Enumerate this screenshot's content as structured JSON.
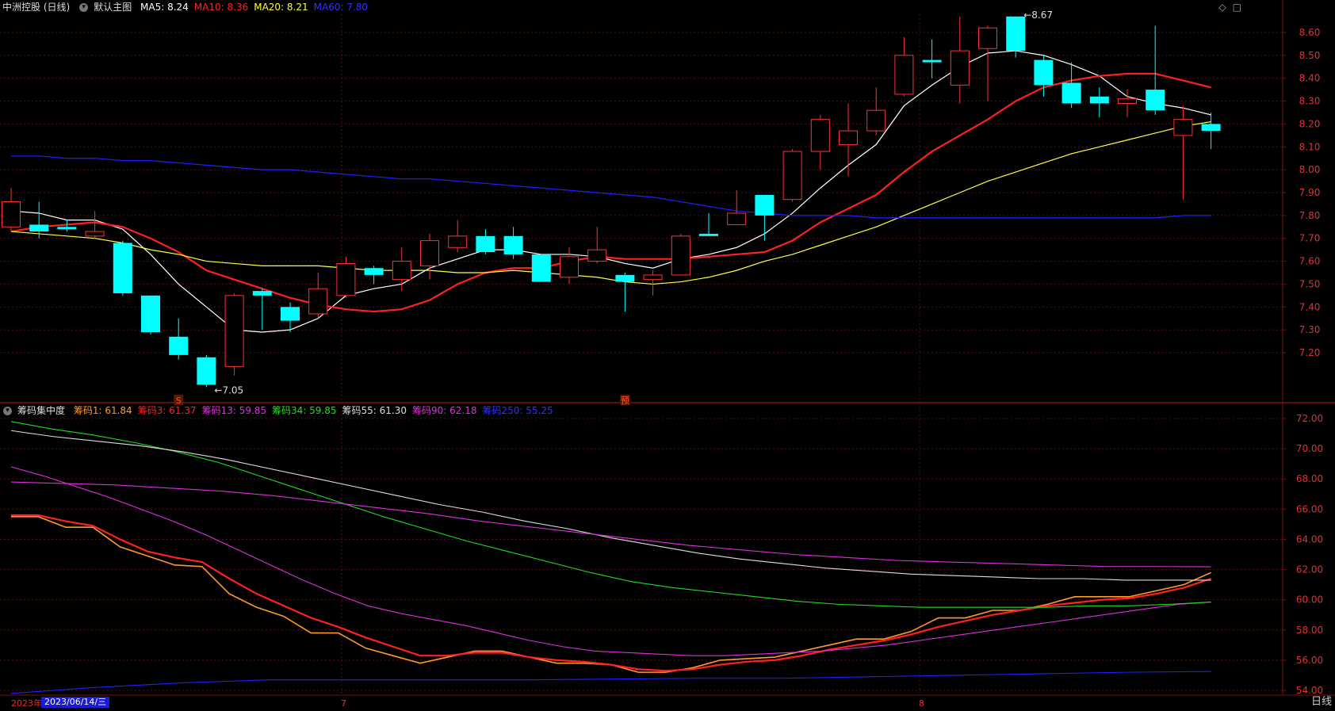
{
  "chart_data": [
    {
      "type": "candlestick",
      "title": "中洲控股 (日线)",
      "subtitle": "默认主图",
      "ma_labels": [
        {
          "text": "MA5: 8.24",
          "color": "#ffffff"
        },
        {
          "text": "MA10: 8.36",
          "color": "#ff2020"
        },
        {
          "text": "MA20: 8.21",
          "color": "#ffff40"
        },
        {
          "text": "MA60: 7.80",
          "color": "#3030ff"
        }
      ],
      "y_ticks": [
        "7.20",
        "7.30",
        "7.40",
        "7.50",
        "7.60",
        "7.70",
        "7.80",
        "7.90",
        "8.00",
        "8.10",
        "8.20",
        "8.30",
        "8.40",
        "8.50",
        "8.60"
      ],
      "ylim": [
        7.0,
        8.72
      ],
      "candles": [
        {
          "o": 7.75,
          "h": 7.92,
          "l": 7.73,
          "c": 7.86
        },
        {
          "o": 7.76,
          "h": 7.86,
          "l": 7.7,
          "c": 7.73
        },
        {
          "o": 7.75,
          "h": 7.78,
          "l": 7.73,
          "c": 7.74
        },
        {
          "o": 7.71,
          "h": 7.82,
          "l": 7.7,
          "c": 7.73
        },
        {
          "o": 7.68,
          "h": 7.69,
          "l": 7.45,
          "c": 7.46
        },
        {
          "o": 7.45,
          "h": 7.45,
          "l": 7.28,
          "c": 7.29
        },
        {
          "o": 7.27,
          "h": 7.35,
          "l": 7.17,
          "c": 7.19
        },
        {
          "o": 7.18,
          "h": 7.19,
          "l": 7.05,
          "c": 7.06
        },
        {
          "o": 7.14,
          "h": 7.46,
          "l": 7.1,
          "c": 7.45
        },
        {
          "o": 7.47,
          "h": 7.48,
          "l": 7.3,
          "c": 7.45
        },
        {
          "o": 7.4,
          "h": 7.42,
          "l": 7.29,
          "c": 7.34
        },
        {
          "o": 7.37,
          "h": 7.55,
          "l": 7.35,
          "c": 7.48
        },
        {
          "o": 7.45,
          "h": 7.62,
          "l": 7.44,
          "c": 7.59
        },
        {
          "o": 7.57,
          "h": 7.58,
          "l": 7.5,
          "c": 7.54
        },
        {
          "o": 7.52,
          "h": 7.66,
          "l": 7.47,
          "c": 7.6
        },
        {
          "o": 7.58,
          "h": 7.72,
          "l": 7.52,
          "c": 7.69
        },
        {
          "o": 7.66,
          "h": 7.78,
          "l": 7.64,
          "c": 7.71
        },
        {
          "o": 7.71,
          "h": 7.74,
          "l": 7.63,
          "c": 7.64
        },
        {
          "o": 7.71,
          "h": 7.75,
          "l": 7.61,
          "c": 7.63
        },
        {
          "o": 7.63,
          "h": 7.63,
          "l": 7.51,
          "c": 7.51
        },
        {
          "o": 7.53,
          "h": 7.66,
          "l": 7.5,
          "c": 7.62
        },
        {
          "o": 7.6,
          "h": 7.75,
          "l": 7.59,
          "c": 7.65
        },
        {
          "o": 7.54,
          "h": 7.55,
          "l": 7.38,
          "c": 7.51
        },
        {
          "o": 7.52,
          "h": 7.56,
          "l": 7.45,
          "c": 7.54
        },
        {
          "o": 7.54,
          "h": 7.72,
          "l": 7.54,
          "c": 7.71
        },
        {
          "o": 7.72,
          "h": 7.81,
          "l": 7.71,
          "c": 7.71
        },
        {
          "o": 7.76,
          "h": 7.91,
          "l": 7.76,
          "c": 7.81
        },
        {
          "o": 7.89,
          "h": 7.89,
          "l": 7.69,
          "c": 7.8
        },
        {
          "o": 7.87,
          "h": 8.09,
          "l": 7.86,
          "c": 8.08
        },
        {
          "o": 8.08,
          "h": 8.24,
          "l": 8.0,
          "c": 8.22
        },
        {
          "o": 8.11,
          "h": 8.29,
          "l": 7.97,
          "c": 8.17
        },
        {
          "o": 8.17,
          "h": 8.36,
          "l": 8.15,
          "c": 8.26
        },
        {
          "o": 8.33,
          "h": 8.58,
          "l": 8.32,
          "c": 8.5
        },
        {
          "o": 8.48,
          "h": 8.57,
          "l": 8.4,
          "c": 8.47
        },
        {
          "o": 8.37,
          "h": 8.67,
          "l": 8.29,
          "c": 8.52
        },
        {
          "o": 8.53,
          "h": 8.63,
          "l": 8.3,
          "c": 8.62
        },
        {
          "o": 8.67,
          "h": 8.67,
          "l": 8.49,
          "c": 8.52
        },
        {
          "o": 8.48,
          "h": 8.5,
          "l": 8.32,
          "c": 8.37
        },
        {
          "o": 8.38,
          "h": 8.47,
          "l": 8.27,
          "c": 8.29
        },
        {
          "o": 8.32,
          "h": 8.36,
          "l": 8.23,
          "c": 8.29
        },
        {
          "o": 8.29,
          "h": 8.35,
          "l": 8.23,
          "c": 8.31
        },
        {
          "o": 8.35,
          "h": 8.63,
          "l": 8.24,
          "c": 8.26
        },
        {
          "o": 8.15,
          "h": 8.28,
          "l": 7.87,
          "c": 8.22
        },
        {
          "o": 8.2,
          "h": 8.25,
          "l": 8.09,
          "c": 8.17
        }
      ],
      "ma": [
        {
          "name": "MA5",
          "color": "#ffffff",
          "values": [
            7.82,
            7.81,
            7.78,
            7.78,
            7.74,
            7.63,
            7.5,
            7.4,
            7.3,
            7.29,
            7.3,
            7.35,
            7.45,
            7.48,
            7.5,
            7.57,
            7.61,
            7.65,
            7.65,
            7.63,
            7.63,
            7.62,
            7.59,
            7.57,
            7.61,
            7.63,
            7.66,
            7.72,
            7.81,
            7.92,
            8.02,
            8.11,
            8.28,
            8.37,
            8.45,
            8.51,
            8.52,
            8.5,
            8.46,
            8.41,
            8.32,
            8.29,
            8.27,
            8.24
          ]
        },
        {
          "name": "MA10",
          "color": "#ff2020",
          "values": [
            7.73,
            7.75,
            7.76,
            7.77,
            7.75,
            7.7,
            7.64,
            7.56,
            7.52,
            7.48,
            7.44,
            7.41,
            7.39,
            7.38,
            7.39,
            7.43,
            7.5,
            7.55,
            7.57,
            7.57,
            7.6,
            7.62,
            7.61,
            7.61,
            7.61,
            7.62,
            7.63,
            7.64,
            7.69,
            7.77,
            7.83,
            7.89,
            7.99,
            8.08,
            8.15,
            8.22,
            8.3,
            8.36,
            8.39,
            8.41,
            8.42,
            8.42,
            8.39,
            8.36
          ]
        },
        {
          "name": "MA20",
          "color": "#ffff40",
          "values": [
            7.73,
            7.72,
            7.71,
            7.7,
            7.68,
            7.65,
            7.63,
            7.6,
            7.59,
            7.58,
            7.58,
            7.58,
            7.57,
            7.56,
            7.56,
            7.56,
            7.55,
            7.55,
            7.56,
            7.55,
            7.54,
            7.53,
            7.51,
            7.5,
            7.51,
            7.53,
            7.56,
            7.6,
            7.63,
            7.67,
            7.71,
            7.75,
            7.8,
            7.85,
            7.9,
            7.95,
            7.99,
            8.03,
            8.07,
            8.1,
            8.13,
            8.16,
            8.19,
            8.21
          ]
        },
        {
          "name": "MA60",
          "color": "#2020ff",
          "values": [
            8.06,
            8.06,
            8.05,
            8.05,
            8.04,
            8.04,
            8.03,
            8.02,
            8.01,
            8.0,
            8.0,
            7.99,
            7.98,
            7.97,
            7.96,
            7.96,
            7.95,
            7.94,
            7.93,
            7.92,
            7.91,
            7.9,
            7.89,
            7.88,
            7.86,
            7.84,
            7.82,
            7.81,
            7.8,
            7.8,
            7.8,
            7.79,
            7.79,
            7.79,
            7.79,
            7.79,
            7.79,
            7.79,
            7.79,
            7.79,
            7.79,
            7.79,
            7.8,
            7.8
          ]
        }
      ],
      "annotations": [
        {
          "text": "7.05",
          "index": 7,
          "price": 7.05
        },
        {
          "text": "8.67",
          "index": 36,
          "price": 8.67
        }
      ],
      "markers": [
        {
          "text": "S",
          "index": 6
        },
        {
          "text": "预",
          "index": 22
        }
      ]
    },
    {
      "type": "line",
      "title": "筹码集中度",
      "labels": [
        {
          "text": "筹码1: 61.84",
          "color": "#ff9930"
        },
        {
          "text": "筹码3: 61.37",
          "color": "#ff2020"
        },
        {
          "text": "筹码13: 59.85",
          "color": "#dd30dd"
        },
        {
          "text": "筹码34: 59.85",
          "color": "#20dd20"
        },
        {
          "text": "筹码55: 61.30",
          "color": "#dddddd"
        },
        {
          "text": "筹码90: 62.18",
          "color": "#dd30dd"
        },
        {
          "text": "筹码250: 55.25",
          "color": "#3030ff"
        }
      ],
      "y_ticks": [
        "54.00",
        "56.00",
        "58.00",
        "60.00",
        "62.00",
        "64.00",
        "66.00",
        "68.00",
        "70.00",
        "72.00"
      ],
      "ylim": [
        53.2,
        72.6
      ],
      "series": [
        {
          "name": "筹码1",
          "color": "#ff9930",
          "values": [
            65.5,
            65.5,
            64.8,
            64.8,
            63.5,
            62.9,
            62.3,
            62.2,
            60.4,
            59.5,
            58.9,
            57.8,
            57.8,
            56.8,
            56.3,
            55.8,
            56.2,
            56.6,
            56.6,
            56.2,
            55.8,
            55.8,
            55.7,
            55.2,
            55.2,
            55.5,
            56.0,
            56.1,
            56.2,
            56.6,
            57.0,
            57.4,
            57.4,
            57.9,
            58.8,
            58.8,
            59.3,
            59.3,
            59.7,
            60.2,
            60.2,
            60.2,
            60.6,
            61.0,
            61.8
          ]
        },
        {
          "name": "筹码3",
          "color": "#ff2020",
          "values": [
            65.6,
            65.6,
            65.2,
            64.9,
            64.0,
            63.2,
            62.8,
            62.5,
            61.4,
            60.4,
            59.6,
            58.8,
            58.2,
            57.5,
            56.9,
            56.3,
            56.3,
            56.5,
            56.5,
            56.2,
            56.0,
            55.9,
            55.7,
            55.4,
            55.3,
            55.4,
            55.7,
            55.9,
            56.0,
            56.3,
            56.7,
            57.0,
            57.3,
            57.7,
            58.2,
            58.6,
            59.0,
            59.3,
            59.6,
            59.8,
            60.0,
            60.1,
            60.4,
            60.8,
            61.4
          ]
        },
        {
          "name": "筹码13",
          "color": "#dd30dd",
          "values": [
            68.8,
            68.2,
            67.5,
            66.8,
            66.0,
            65.2,
            64.3,
            63.3,
            62.3,
            61.3,
            60.4,
            59.6,
            59.1,
            58.7,
            58.3,
            57.8,
            57.3,
            56.9,
            56.6,
            56.5,
            56.4,
            56.3,
            56.3,
            56.4,
            56.5,
            56.6,
            56.8,
            57.0,
            57.3,
            57.6,
            57.9,
            58.2,
            58.5,
            58.8,
            59.1,
            59.4,
            59.7,
            59.85
          ]
        },
        {
          "name": "筹码34",
          "color": "#20dd20",
          "values": [
            71.8,
            71.3,
            70.9,
            70.4,
            69.8,
            69.1,
            68.2,
            67.3,
            66.4,
            65.5,
            64.7,
            63.9,
            63.2,
            62.5,
            61.8,
            61.2,
            60.8,
            60.5,
            60.2,
            59.9,
            59.7,
            59.6,
            59.5,
            59.5,
            59.5,
            59.5,
            59.6,
            59.6,
            59.7,
            59.85
          ]
        },
        {
          "name": "筹码55",
          "color": "#dddddd",
          "values": [
            71.2,
            70.8,
            70.5,
            70.2,
            69.8,
            69.3,
            68.7,
            68.1,
            67.5,
            66.9,
            66.3,
            65.8,
            65.2,
            64.7,
            64.1,
            63.6,
            63.1,
            62.7,
            62.4,
            62.1,
            61.9,
            61.7,
            61.6,
            61.5,
            61.4,
            61.4,
            61.3,
            61.3,
            61.3
          ]
        },
        {
          "name": "筹码90",
          "color": "#dd30dd",
          "values": [
            67.8,
            67.7,
            67.6,
            67.4,
            67.2,
            66.9,
            66.5,
            66.1,
            65.7,
            65.2,
            64.8,
            64.4,
            64.0,
            63.6,
            63.3,
            63.0,
            62.8,
            62.6,
            62.5,
            62.4,
            62.3,
            62.2,
            62.2,
            62.18
          ]
        },
        {
          "name": "筹码250",
          "color": "#2020ff",
          "values": [
            53.8,
            54.2,
            54.5,
            54.7,
            54.7,
            54.7,
            54.7,
            54.75,
            54.8,
            54.8,
            54.9,
            55.0,
            55.1,
            55.2,
            55.25
          ]
        }
      ]
    }
  ],
  "ui": {
    "top_right_icons": [
      "◇",
      "□"
    ],
    "date_left": "2023年",
    "date_selected": "2023/06/14/三",
    "month_7": "7",
    "month_8": "8",
    "period_label": "日线"
  },
  "colors": {
    "up": "#ff3030",
    "down": "#00ffff",
    "grid": "#551010",
    "axis": "#7a1010",
    "tick": "#dd3333"
  }
}
